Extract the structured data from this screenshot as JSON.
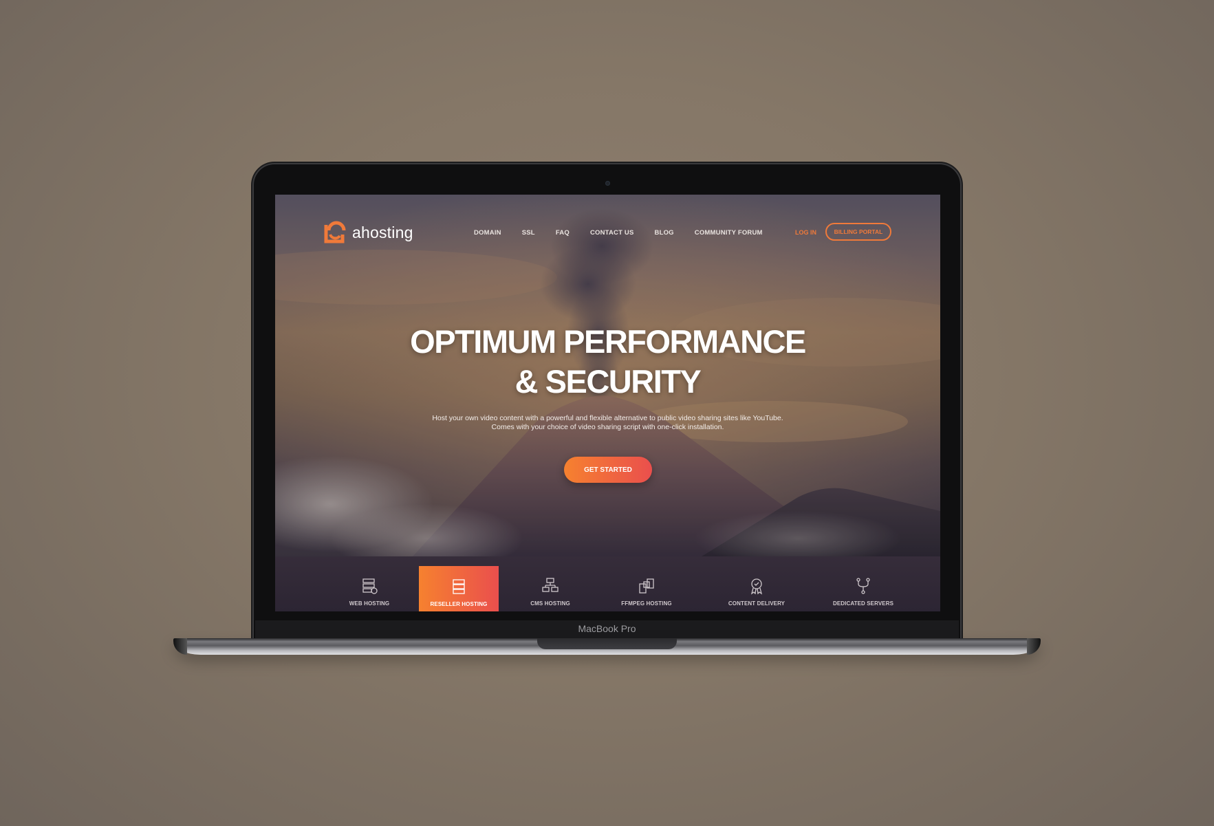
{
  "device": {
    "bezel_label": "MacBook Pro"
  },
  "brand": {
    "name": "ahosting",
    "accent_color": "#f07a3a",
    "gradient_start": "#f6812f",
    "gradient_end": "#ea4f4d"
  },
  "nav": {
    "items": [
      {
        "label": "DOMAIN"
      },
      {
        "label": "SSL"
      },
      {
        "label": "FAQ"
      },
      {
        "label": "CONTACT US"
      },
      {
        "label": "BLOG"
      },
      {
        "label": "COMMUNITY FORUM"
      }
    ],
    "login_label": "LOG IN",
    "billing_label": "BILLING PORTAL"
  },
  "hero": {
    "headline_line1": "OPTIMUM PERFORMANCE",
    "headline_line2": "& SECURITY",
    "subtext_line1": "Host your own video content with a powerful and flexible alternative to public video sharing sites like YouTube.",
    "subtext_line2": "Comes with your choice of video sharing script with one-click installation.",
    "cta_label": "GET STARTED"
  },
  "services": {
    "items": [
      {
        "label": "WEB HOSTING",
        "icon": "web-hosting-icon",
        "active": false
      },
      {
        "label": "RESELLER HOSTING",
        "icon": "reseller-hosting-icon",
        "active": true
      },
      {
        "label": "CMS HOSTING",
        "icon": "cms-hosting-icon",
        "active": false
      },
      {
        "label": "FFMPEG HOSTING",
        "icon": "ffmpeg-hosting-icon",
        "active": false
      },
      {
        "label": "CONTENT DELIVERY",
        "icon": "content-delivery-icon",
        "active": false
      },
      {
        "label": "DEDICATED SERVERS",
        "icon": "dedicated-servers-icon",
        "active": false
      }
    ]
  }
}
